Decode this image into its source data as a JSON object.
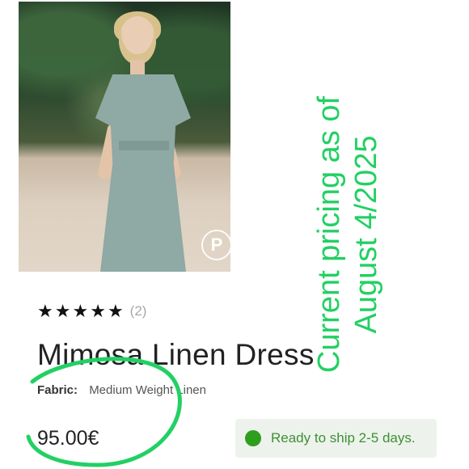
{
  "product": {
    "rating_count": "(2)",
    "stars": [
      "★",
      "★",
      "★",
      "★",
      "★"
    ],
    "title": "Mimosa Linen Dress",
    "fabric_label": "Fabric:",
    "fabric_value": "Medium Weight Linen",
    "price": "95.00€"
  },
  "shipping": {
    "text": "Ready to ship 2-5 days."
  },
  "annotation": {
    "line1": "Current pricing as of",
    "line2": "August 4/2025",
    "color": "#22d063"
  },
  "icons": {
    "star": "star-icon",
    "pinterest": "pinterest-icon",
    "status": "green-dot-icon"
  }
}
